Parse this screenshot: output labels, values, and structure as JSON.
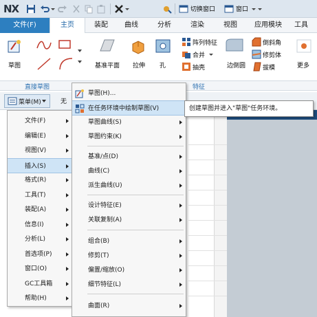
{
  "quick_access": {
    "logo": "NX",
    "switch_window": "切换窗口",
    "window": "窗口"
  },
  "tabs": [
    "文件(F)",
    "主页",
    "装配",
    "曲线",
    "分析",
    "渲染",
    "视图",
    "应用模块",
    "工具"
  ],
  "ribbon": {
    "sketch": "草图",
    "datum_plane": "基准平面",
    "extrude": "拉伸",
    "hole": "孔",
    "pattern_feature": "阵列特征",
    "unite": "合并",
    "shell": "抽壳",
    "edge_blend": "边倒圆",
    "chamfer": "倒斜角",
    "trim_body": "修剪体",
    "draft": "拔模",
    "more": "更多",
    "group_direct_sketch": "直接草图",
    "group_feature": "特征"
  },
  "toolbar": {
    "menu_button": "菜单(M)",
    "filter_partial": "无"
  },
  "main_menu": [
    {
      "label": "文件(F)",
      "submenu": true
    },
    {
      "label": "编辑(E)",
      "submenu": true
    },
    {
      "label": "视图(V)",
      "submenu": true
    },
    {
      "label": "插入(S)",
      "submenu": true,
      "highlighted": true
    },
    {
      "label": "格式(R)",
      "submenu": true
    },
    {
      "label": "工具(T)",
      "submenu": true
    },
    {
      "label": "装配(A)",
      "submenu": true
    },
    {
      "label": "信息(I)",
      "submenu": true
    },
    {
      "label": "分析(L)",
      "submenu": true
    },
    {
      "label": "首选项(P)",
      "submenu": true
    },
    {
      "label": "窗口(O)",
      "submenu": true
    },
    {
      "label": "GC工具箱",
      "submenu": true
    },
    {
      "label": "帮助(H)",
      "submenu": true
    }
  ],
  "insert_menu": [
    {
      "label": "草图(H)...",
      "icon": "sketch-icon"
    },
    {
      "label": "在任务环境中绘制草图(V)",
      "icon": "sketch-task-icon",
      "highlighted": true
    },
    {
      "label": "草图曲线(S)",
      "submenu": true
    },
    {
      "label": "草图约束(K)",
      "submenu": true
    },
    {
      "label": "基准/点(D)",
      "submenu": true
    },
    {
      "label": "曲线(C)",
      "submenu": true
    },
    {
      "label": "派生曲线(U)",
      "submenu": true
    },
    {
      "label": "设计特征(E)",
      "submenu": true
    },
    {
      "label": "关联复制(A)",
      "submenu": true
    },
    {
      "label": "组合(B)",
      "submenu": true
    },
    {
      "label": "修剪(T)",
      "submenu": true
    },
    {
      "label": "偏置/缩放(O)",
      "submenu": true
    },
    {
      "label": "细节特征(L)",
      "submenu": true
    },
    {
      "label": "曲面(R)",
      "submenu": true
    }
  ],
  "tooltip": "创建草图并进入\"草图\"任务环境。",
  "colors": {
    "file_tab": "#2d7fc0",
    "highlight": "#cfe4f6",
    "grey_area": "#c4ccd4"
  }
}
